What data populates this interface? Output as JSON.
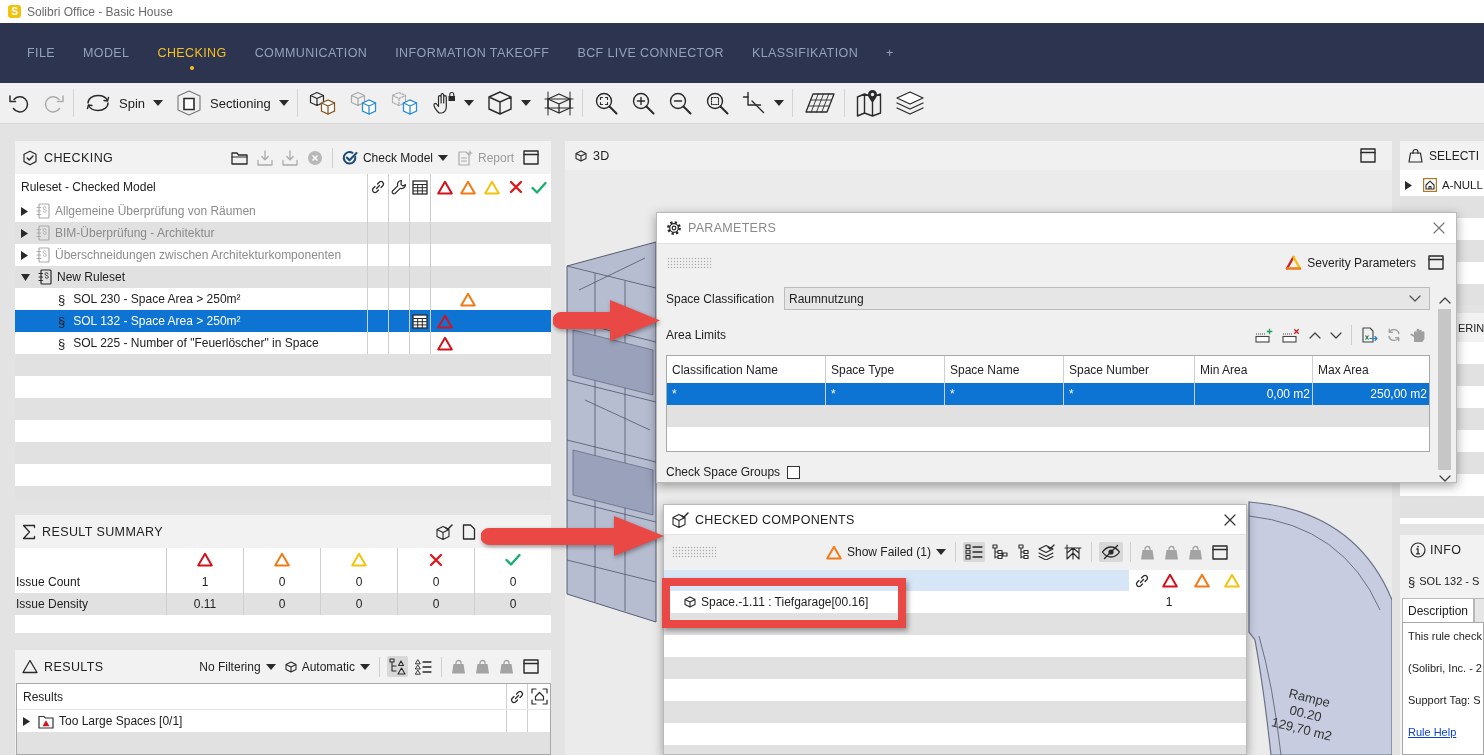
{
  "window": {
    "logo_text": "S",
    "title": "Solibri Office - Basic House"
  },
  "menu": [
    {
      "label": "FILE",
      "selected": false
    },
    {
      "label": "MODEL",
      "selected": false
    },
    {
      "label": "CHECKING",
      "selected": true
    },
    {
      "label": "COMMUNICATION",
      "selected": false
    },
    {
      "label": "INFORMATION TAKEOFF",
      "selected": false
    },
    {
      "label": "BCF LIVE CONNECTOR",
      "selected": false
    },
    {
      "label": "KLASSIFIKATION",
      "selected": false
    },
    {
      "label": "+",
      "selected": false
    }
  ],
  "toolbar": {
    "undo": {
      "disabled": false
    },
    "redo": {
      "disabled": true
    },
    "spin": {
      "label": "Spin"
    },
    "sectioning": {
      "label": "Sectioning"
    }
  },
  "checking_panel": {
    "title": "CHECKING",
    "actions": [
      {
        "disabled": false
      },
      {
        "disabled": true
      },
      {
        "disabled": true
      },
      {
        "disabled": true
      }
    ],
    "check_model": {
      "label": "Check Model"
    },
    "report": {
      "label": "Report",
      "disabled": true
    },
    "tree_header": "Ruleset - Checked Model",
    "rulesets": [
      {
        "label": "Allgemeine Überprüfung von Räumen",
        "expanded": false,
        "disabled": true,
        "selected": false
      },
      {
        "label": "BIM-Überprüfung - Architektur",
        "expanded": false,
        "disabled": true,
        "selected": false
      },
      {
        "label": "Überschneidungen zwischen Architekturkomponenten",
        "expanded": false,
        "disabled": true,
        "selected": false
      },
      {
        "label": "New Ruleset",
        "expanded": true,
        "disabled": false,
        "selected": false,
        "children": [
          {
            "marker": "§",
            "label": "SOL 230 - Space Area > 250m²",
            "selected": false,
            "table": false,
            "critical": false,
            "moderate": true,
            "low": false
          },
          {
            "marker": "§",
            "label": "SOL 132 - Space Area > 250m²",
            "selected": true,
            "table": true,
            "critical": true,
            "moderate": false,
            "low": false
          },
          {
            "marker": "§",
            "label": "SOL 225 - Number of \"Feuerlöscher\" in Space",
            "selected": false,
            "table": false,
            "critical": true,
            "moderate": false,
            "low": false
          }
        ]
      }
    ]
  },
  "result_summary": {
    "title": "RESULT SUMMARY",
    "rows": [
      {
        "label": "Issue Count",
        "values": [
          "1",
          "0",
          "0",
          "0",
          "0"
        ]
      },
      {
        "label": "Issue Density",
        "values": [
          "0.11",
          "0",
          "0",
          "0",
          "0"
        ]
      }
    ]
  },
  "results_panel": {
    "title": "RESULTS",
    "filter": "No Filtering",
    "mode": "Automatic",
    "views": [
      {
        "selected": true
      },
      {
        "selected": false
      }
    ],
    "tag_buttons": [
      {
        "disabled": true
      },
      {
        "disabled": true
      },
      {
        "disabled": true
      }
    ],
    "header": "Results",
    "rows": [
      {
        "label": "Too Large Spaces [0/1]",
        "expanded": false,
        "selected": false
      }
    ]
  },
  "viewport": {
    "title": "3D",
    "labels": [
      "Rampe",
      "00.20",
      "129,70 m2"
    ]
  },
  "selection_panel": {
    "title": "SELECTI",
    "rows": [
      {
        "label": "A-NULL",
        "expanded": false,
        "selected": false
      }
    ]
  },
  "second_panel": {
    "title": "ERIN"
  },
  "info_panel": {
    "title": "INFO",
    "rule_marker": "§",
    "rule": "SOL 132 - S",
    "tabs": [
      {
        "label": "Description",
        "selected": true
      },
      {
        "selected": false
      }
    ],
    "lines": [
      "This rule check",
      "(Solibri, Inc. - 2",
      "Support Tag: S"
    ],
    "link": "Rule Help"
  },
  "parameters_dialog": {
    "title": "PARAMETERS",
    "severity_button": "Severity Parameters",
    "classification": {
      "label": "Space Classification",
      "value": "Raumnutzung"
    },
    "area_limits": {
      "label": "Area Limits",
      "actions": [
        {
          "disabled": false
        },
        {
          "disabled": false
        },
        {
          "disabled": false
        },
        {
          "disabled": false
        },
        {
          "disabled": false
        },
        {
          "disabled": true
        },
        {
          "disabled": true
        }
      ],
      "columns": [
        "Classification Name",
        "Space Type",
        "Space Name",
        "Space Number",
        "Min Area",
        "Max Area"
      ],
      "rows": [
        {
          "selected": true,
          "cells": [
            "*",
            "*",
            "*",
            "*",
            "0,00 m2",
            "250,00 m2"
          ]
        }
      ]
    },
    "check_space_groups": {
      "label": "Check Space Groups",
      "checked": false
    }
  },
  "checked_components": {
    "title": "CHECKED COMPONENTS",
    "filter": "Show Failed (1)",
    "views": [
      {
        "selected": true
      },
      {
        "selected": false
      },
      {
        "selected": false
      },
      {
        "selected": false
      },
      {
        "selected": false
      }
    ],
    "hide_toggle": {
      "selected": true
    },
    "tag_buttons": [
      {
        "disabled": true
      },
      {
        "disabled": true
      },
      {
        "disabled": true
      }
    ],
    "rows": [
      {
        "label": "Space.-1.11 : Tiefgarage[00.16]",
        "counts": {
          "critical": "1"
        }
      }
    ]
  },
  "annotations": [
    {
      "kind": "arrow"
    },
    {
      "kind": "arrow"
    },
    {
      "kind": "frame"
    }
  ]
}
